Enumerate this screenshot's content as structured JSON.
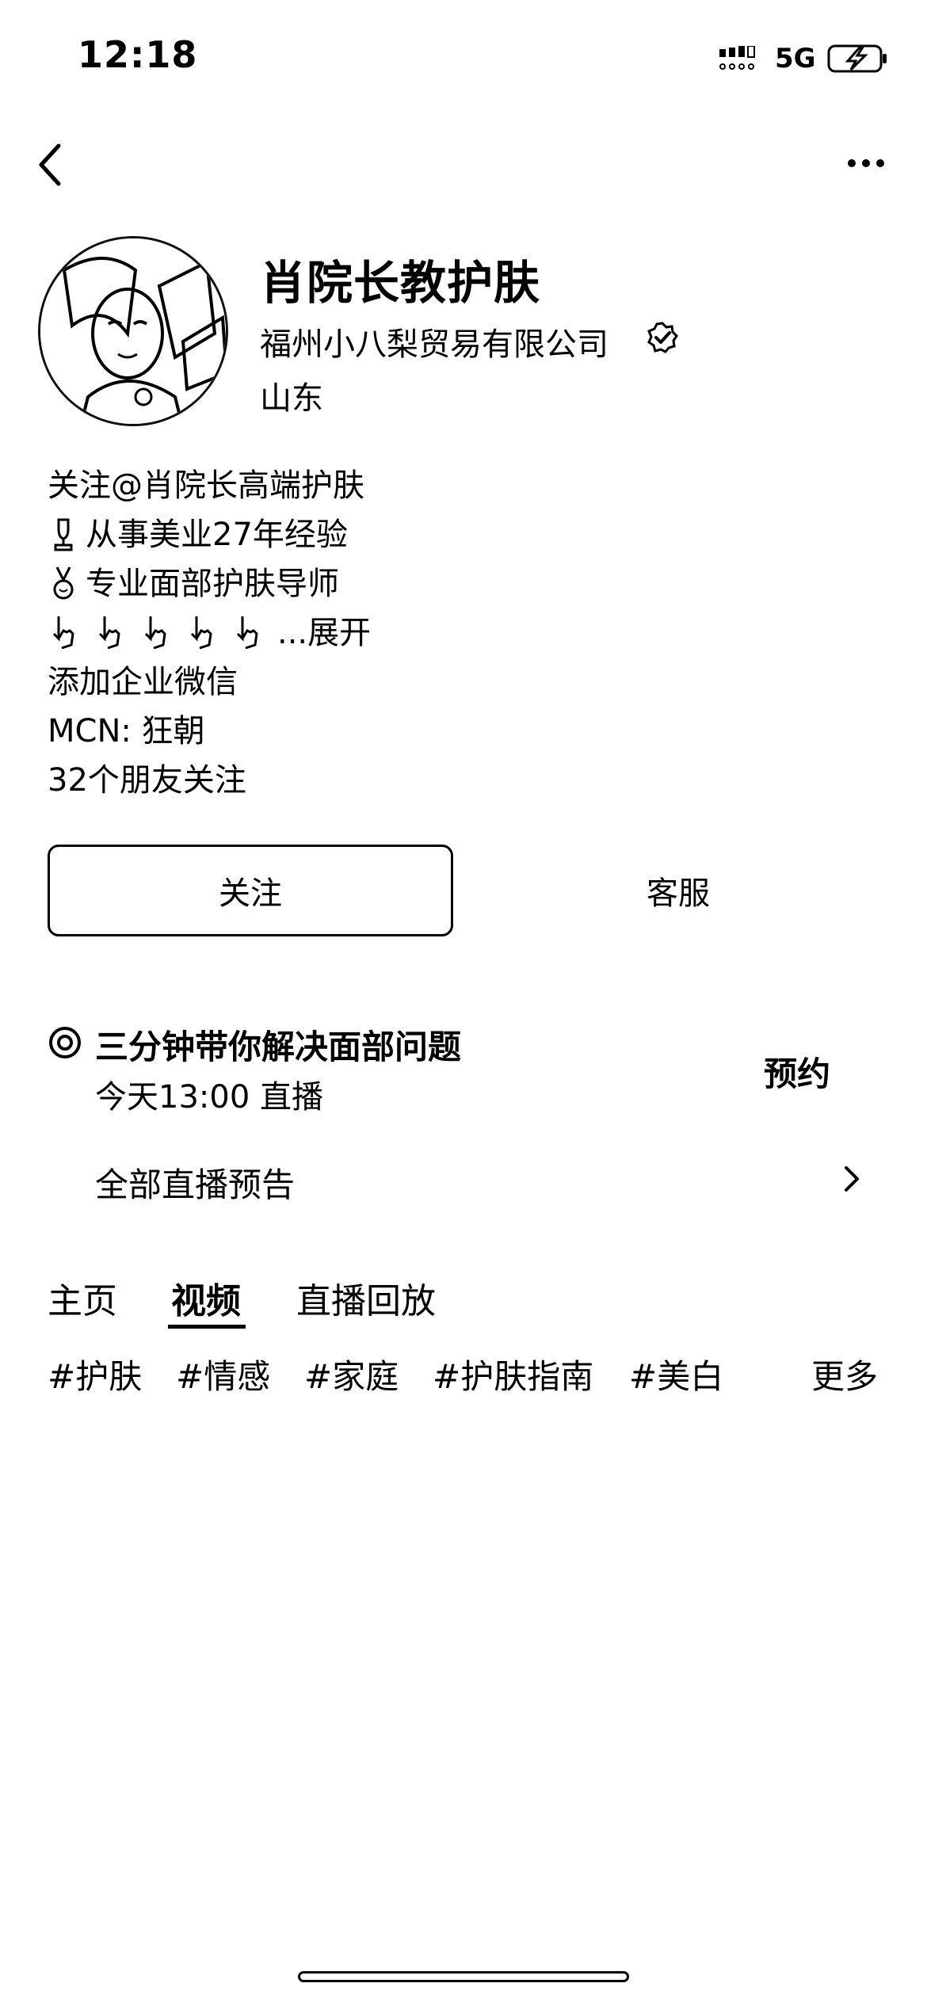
{
  "status_bar": {
    "time": "12:18",
    "network": "5G"
  },
  "profile": {
    "name": "肖院长教护肤",
    "company": "福州小八梨贸易有限公司",
    "region": "山东"
  },
  "bio": {
    "line1": "关注@肖院长高端护肤",
    "line2": "从事美业27年经验",
    "line3": "专业面部护肤导师",
    "expand": "...展开",
    "line5": "添加企业微信",
    "line6": "MCN: 狂朝",
    "line7": "32个朋友关注"
  },
  "actions": {
    "follow_label": "关注",
    "service_label": "客服"
  },
  "live": {
    "title": "三分钟带你解决面部问题",
    "time": "今天13:00 直播",
    "reserve_label": "预约",
    "all_label": "全部直播预告"
  },
  "tabs": [
    {
      "label": "主页",
      "active": false
    },
    {
      "label": "视频",
      "active": true
    },
    {
      "label": "直播回放",
      "active": false
    }
  ],
  "tags": [
    "#护肤",
    "#情感",
    "#家庭",
    "#护肤指南",
    "#美白"
  ],
  "tags_more": "更多",
  "icons": {
    "back": "chevron-left-icon",
    "more": "more-dots-icon",
    "verified": "verified-badge-icon",
    "live": "target-icon",
    "arrow": "chevron-right-icon"
  }
}
